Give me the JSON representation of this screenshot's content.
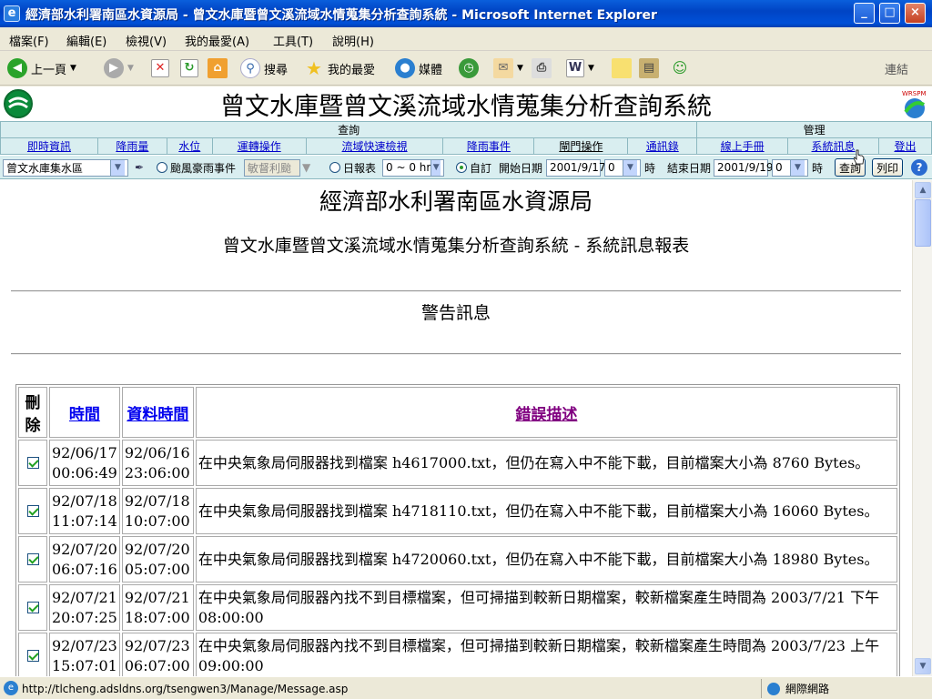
{
  "window": {
    "title": "經濟部水利署南區水資源局 - 曾文水庫暨曾文溪流域水情蒐集分析查詢系統 - Microsoft Internet Explorer",
    "icon": "ie-icon",
    "controls": {
      "minimize": "0",
      "maximize": "1",
      "close": "r"
    }
  },
  "menubar": {
    "items": [
      "檔案(F)",
      "編輯(E)",
      "檢視(V)",
      "我的最愛(A)",
      "工具(T)",
      "說明(H)"
    ]
  },
  "toolbar": {
    "back": "上一頁",
    "search": "搜尋",
    "favorites": "我的最愛",
    "media": "媒體",
    "links": "連結"
  },
  "header": {
    "system_title": "曾文水庫暨曾文溪流域水情蒐集分析查詢系統",
    "logo_right_text": "WRSPM"
  },
  "nav": {
    "group_query": "查詢",
    "group_manage": "管理",
    "items": [
      "即時資訊",
      "降雨量",
      "水位",
      "運轉操作",
      "流域快速檢視",
      "降雨事件",
      "閘門操作",
      "通訊錄",
      "線上手冊",
      "系統訊息",
      "登出"
    ]
  },
  "filter": {
    "area_select": "曾文水庫集水區",
    "typhoon_label": "颱風豪雨事件",
    "typhoon_select": "敏督利颱",
    "daily_label": "日報表",
    "daily_select": "0 ~ 0 hr",
    "custom_label": "自訂",
    "start_label": "開始日期",
    "start_date": "2001/9/17",
    "start_hour": "0",
    "hour_unit": "時",
    "end_label": "結束日期",
    "end_date": "2001/9/19",
    "end_hour": "0",
    "query_button": "查詢",
    "print_button": "列印",
    "selected_mode": "custom"
  },
  "report": {
    "agency": "經濟部水利署南區水資源局",
    "subtitle": "曾文水庫暨曾文溪流域水情蒐集分析查詢系統 - 系統訊息報表",
    "section": "警告訊息",
    "columns": {
      "delete": "刪除",
      "time": "時間",
      "data_time": "資料時間",
      "error": "錯誤描述"
    },
    "rows": [
      {
        "time": "92/06/17 00:06:49",
        "data_time": "92/06/16 23:06:00",
        "error": "在中央氣象局伺服器找到檔案 h4617000.txt，但仍在寫入中不能下載，目前檔案大小為 8760 Bytes。",
        "checked": true
      },
      {
        "time": "92/07/18 11:07:14",
        "data_time": "92/07/18 10:07:00",
        "error": "在中央氣象局伺服器找到檔案 h4718110.txt，但仍在寫入中不能下載，目前檔案大小為 16060 Bytes。",
        "checked": true
      },
      {
        "time": "92/07/20 06:07:16",
        "data_time": "92/07/20 05:07:00",
        "error": "在中央氣象局伺服器找到檔案 h4720060.txt，但仍在寫入中不能下載，目前檔案大小為 18980 Bytes。",
        "checked": true
      },
      {
        "time": "92/07/21 20:07:25",
        "data_time": "92/07/21 18:07:00",
        "error": "在中央氣象局伺服器內找不到目標檔案，但可掃描到較新日期檔案，較新檔案產生時間為 2003/7/21 下午 08:00:00",
        "checked": true
      },
      {
        "time": "92/07/23 15:07:01",
        "data_time": "92/07/23 06:07:00",
        "error": "在中央氣象局伺服器內找不到目標檔案，但可掃描到較新日期檔案，較新檔案產生時間為 2003/7/23 上午 09:00:00",
        "checked": true
      }
    ]
  },
  "status": {
    "url": "http://tlcheng.adsldns.org/tsengwen3/Manage/Message.asp",
    "zone": "網際網路"
  },
  "colors": {
    "titlebar": "#0044c4",
    "nav_bg": "#d9eef0",
    "link": "#0000cc"
  }
}
